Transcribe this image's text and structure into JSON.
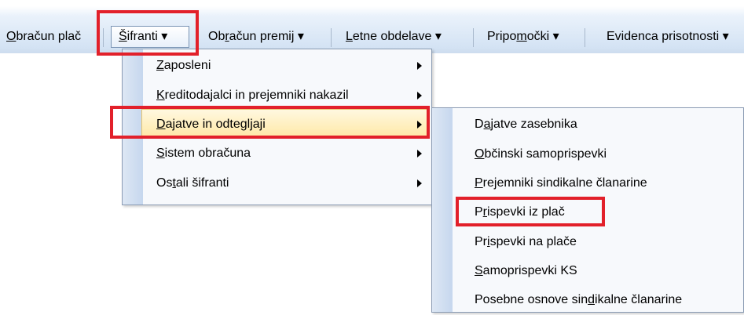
{
  "menubar": {
    "items": [
      {
        "pre": "",
        "ul": "O",
        "post": "bračun plač"
      },
      {
        "pre": "",
        "ul": "Š",
        "post": "ifranti ▾"
      },
      {
        "pre": "Ob",
        "ul": "r",
        "post": "ačun premij ▾"
      },
      {
        "pre": "",
        "ul": "L",
        "post": "etne obdelave ▾"
      },
      {
        "pre": "Pripo",
        "ul": "m",
        "post": "očki ▾"
      },
      {
        "pre": "",
        "ul": "",
        "post": "Evidenca prisotnosti ▾"
      }
    ]
  },
  "sifranti_menu": {
    "items": [
      {
        "pre": "",
        "ul": "Z",
        "post": "aposleni"
      },
      {
        "pre": "",
        "ul": "K",
        "post": "reditodajalci in prejemniki nakazil"
      },
      {
        "pre": "",
        "ul": "D",
        "post": "ajatve in odtegljaji"
      },
      {
        "pre": "",
        "ul": "S",
        "post": "istem obračuna"
      },
      {
        "pre": "Os",
        "ul": "t",
        "post": "ali šifranti"
      }
    ]
  },
  "dajatve_menu": {
    "items": [
      {
        "pre": "D",
        "ul": "a",
        "post": "jatve zasebnika"
      },
      {
        "pre": "",
        "ul": "O",
        "post": "bčinski samoprispevki"
      },
      {
        "pre": "",
        "ul": "P",
        "post": "rejemniki sindikalne članarine"
      },
      {
        "pre": "P",
        "ul": "r",
        "post": "ispevki iz plač"
      },
      {
        "pre": "Pr",
        "ul": "i",
        "post": "spevki na plače"
      },
      {
        "pre": "",
        "ul": "S",
        "post": "amoprispevki KS"
      },
      {
        "pre": "Posebne osnove sin",
        "ul": "d",
        "post": "ikalne članarine"
      }
    ]
  },
  "colors": {
    "highlight_box": "#e2202a",
    "hover": "#ffe9a8"
  }
}
